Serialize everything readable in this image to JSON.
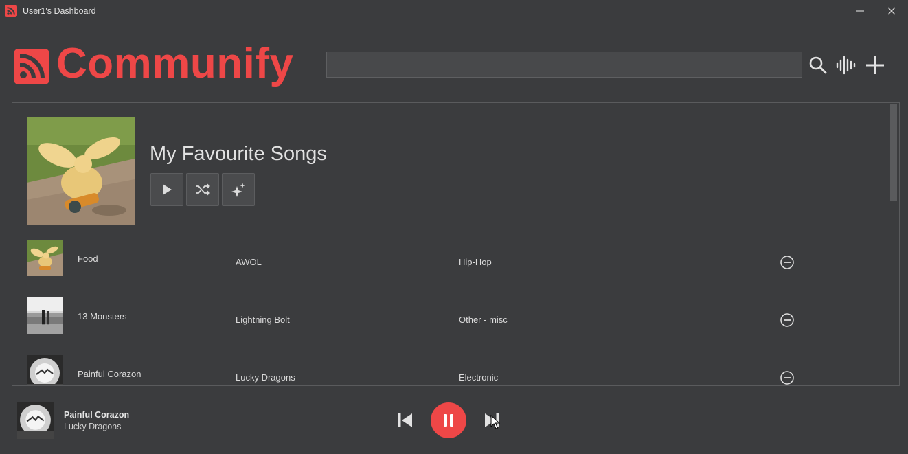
{
  "window": {
    "title": "User1's Dashboard",
    "icons": {
      "app": "rss-icon",
      "minimize": "minimize-icon",
      "close": "close-icon"
    }
  },
  "header": {
    "logo_text": "Communify",
    "search": {
      "value": "",
      "placeholder": ""
    },
    "icons": [
      "search-icon",
      "waveform-icon",
      "plus-icon"
    ]
  },
  "colors": {
    "accent": "#ee4747",
    "background": "#3b3c3e",
    "panel_border": "#5a5b5d",
    "button_bg": "#4a4b4d"
  },
  "playlist": {
    "title": "My Favourite Songs",
    "buttons": [
      "play-icon",
      "shuffle-icon",
      "sparkle-icon"
    ]
  },
  "songs": [
    {
      "title": "Food",
      "artist": "AWOL",
      "genre": "Hip-Hop"
    },
    {
      "title": "13 Monsters",
      "artist": "Lightning Bolt",
      "genre": "Other - misc"
    },
    {
      "title": "Painful Corazon",
      "artist": "Lucky Dragons",
      "genre": "Electronic"
    }
  ],
  "now_playing": {
    "title": "Painful Corazon",
    "artist": "Lucky Dragons",
    "state": "playing",
    "controls": [
      "skip-previous-icon",
      "pause-icon",
      "skip-next-icon"
    ]
  }
}
